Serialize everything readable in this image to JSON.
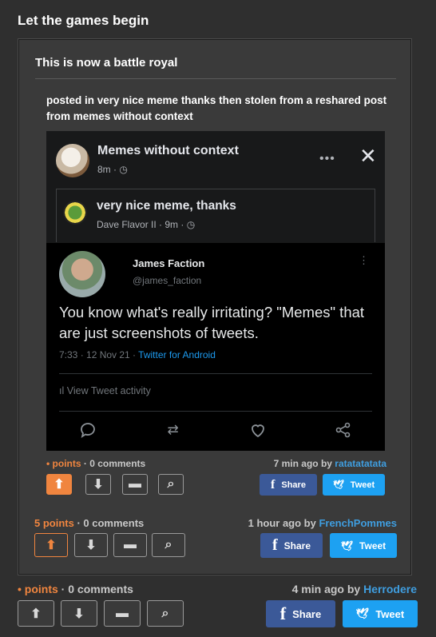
{
  "outer_title": "Let the games begin",
  "card_title": "This is now a battle royal",
  "posted_text": "posted in very nice meme thanks then stolen from a reshared post from memes without context",
  "screenshot": {
    "page_name": "Memes without context",
    "page_time": "8m · ",
    "shared_name": "very nice meme, thanks",
    "shared_sub": "Dave Flavor II · 9m · ",
    "tweet_name": "James Faction",
    "tweet_handle": "@james_faction",
    "tweet_text": "You know what's really irritating? \"Memes\" that are just screenshots of tweets.",
    "tweet_time": "7:33 · 12 Nov 21 · ",
    "tweet_client": "Twitter for Android",
    "tweet_activity": "View Tweet activity"
  },
  "inner_meta": {
    "points": "• points",
    "comments": " · 0 comments",
    "time": "7 min ago by ",
    "user": "ratatatatata"
  },
  "card_meta": {
    "points": "5 points",
    "comments": " · 0 comments",
    "time": "1 hour ago by ",
    "user": "FrenchPommes"
  },
  "outer_meta": {
    "points": "• points",
    "comments": " · 0 comments",
    "time": "4 min ago by ",
    "user": "Herrodere"
  },
  "share_label": "Share",
  "tweet_label": "Tweet",
  "colors": {
    "points": "#f0853f",
    "user_link": "#3f9ee0",
    "facebook": "#3b5998",
    "twitter": "#1da1f2"
  }
}
